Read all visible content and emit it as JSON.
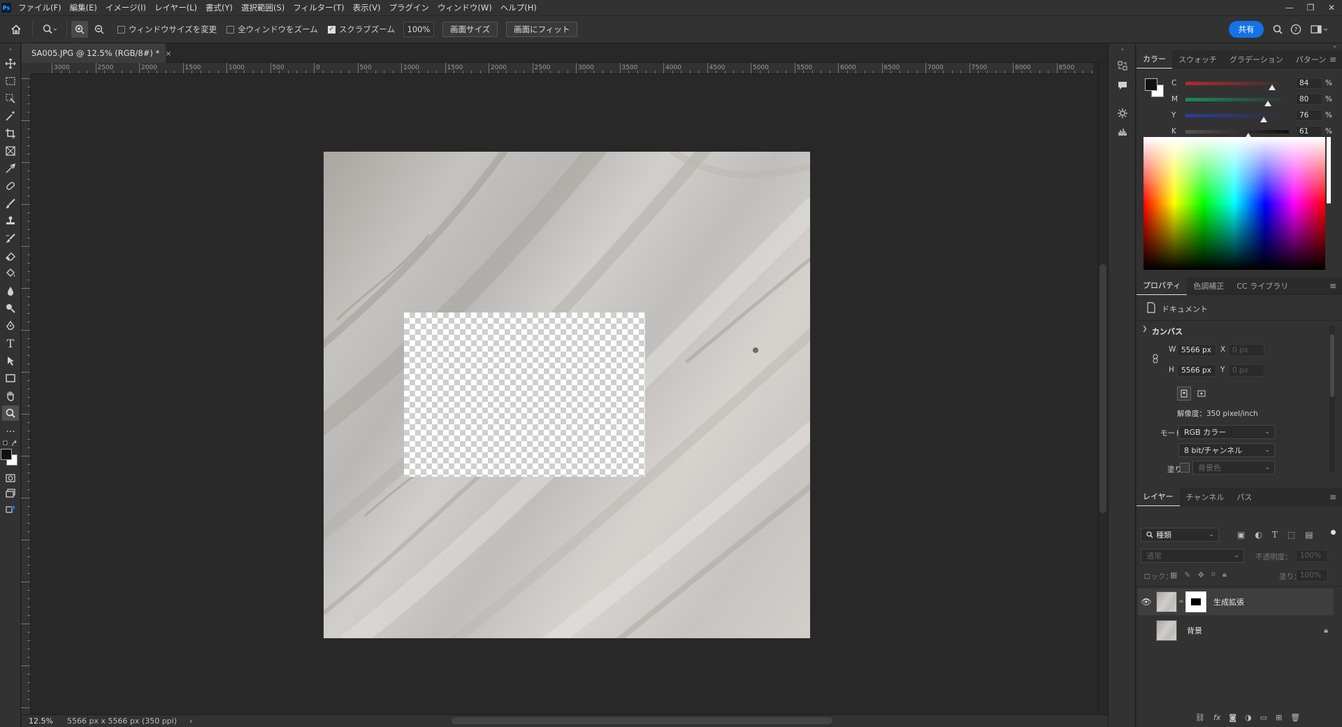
{
  "app": {
    "logo": "Ps"
  },
  "menu": [
    "ファイル(F)",
    "編集(E)",
    "イメージ(I)",
    "レイヤー(L)",
    "書式(Y)",
    "選択範囲(S)",
    "フィルター(T)",
    "表示(V)",
    "プラグイン",
    "ウィンドウ(W)",
    "ヘルプ(H)"
  ],
  "window_controls": {
    "minimize": "—",
    "restore": "❐",
    "close": "✕"
  },
  "options": {
    "resize_windows": "ウィンドウサイズを変更",
    "zoom_all": "全ウィンドウをズーム",
    "scrubby_zoom": "スクラブズーム",
    "zoom_value": "100%",
    "screen_size": "画面サイズ",
    "fit_screen": "画面にフィット",
    "share": "共有"
  },
  "document_tab": {
    "title": "SA005.JPG @ 12.5% (RGB/8#) *",
    "close": "×"
  },
  "ruler": {
    "labels": [
      "3000",
      "2500",
      "2000",
      "1500",
      "1000",
      "500",
      "0",
      "500",
      "1000",
      "1500",
      "2000",
      "2500",
      "3000",
      "3500",
      "4000",
      "4500",
      "5000",
      "5500",
      "6000",
      "6500",
      "7000",
      "7500",
      "8000",
      "8500"
    ]
  },
  "status": {
    "zoom": "12.5%",
    "doc_info": "5566 px x 5566 px (350 ppi)",
    "arrow": "›"
  },
  "color_panel": {
    "tabs": [
      "カラー",
      "スウォッチ",
      "グラデーション",
      "パターン"
    ],
    "sliders": [
      {
        "label": "C",
        "value": "84",
        "fraction": 0.84,
        "grad": "linear-gradient(to right,#b22b2b,#33302f)"
      },
      {
        "label": "M",
        "value": "80",
        "fraction": 0.8,
        "grad": "linear-gradient(to right,#1c8a5a,#33302f)"
      },
      {
        "label": "Y",
        "value": "76",
        "fraction": 0.76,
        "grad": "linear-gradient(to right,#2a3d9a,#33302f)"
      },
      {
        "label": "K",
        "value": "61",
        "fraction": 0.61,
        "grad": "linear-gradient(to right,#555555,#111111)"
      }
    ],
    "percent": "%"
  },
  "properties_panel": {
    "tabs": [
      "プロパティ",
      "色調補正",
      "CC ライブラリ"
    ],
    "doc_label": "ドキュメント",
    "section": "カンバス",
    "w_label": "W",
    "w_value": "5566 px",
    "h_label": "H",
    "h_value": "5566 px",
    "x_label": "X",
    "x_value": "0 px",
    "y_label": "Y",
    "y_value": "0 px",
    "resolution": "解像度：350 pixel/inch",
    "mode_label": "モード",
    "mode_value": "RGB カラー",
    "bit_value": "8 bit/チャンネル",
    "fill_label": "塗り",
    "fill_value": "背景色"
  },
  "layers_panel": {
    "tabs": [
      "レイヤー",
      "チャンネル",
      "パス"
    ],
    "filter": "種類",
    "blend": "通常",
    "opacity_label": "不透明度：",
    "opacity_value": "100%",
    "lock_label": "ロック：",
    "fill_label": "塗り：",
    "fill_value": "100%",
    "layers": [
      {
        "name": "生成拡張"
      },
      {
        "name": "背景"
      }
    ]
  }
}
